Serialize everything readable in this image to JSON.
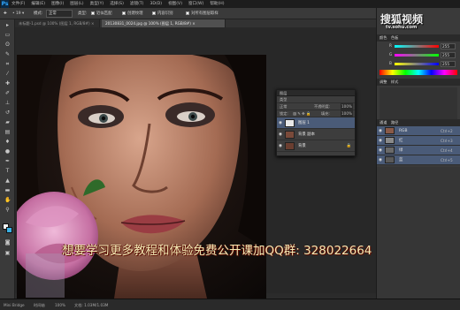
{
  "app": {
    "logo": "Ps"
  },
  "menu": [
    "文件(F)",
    "编辑(E)",
    "图像(I)",
    "图层(L)",
    "类型(Y)",
    "选择(S)",
    "滤镜(T)",
    "3D(D)",
    "视图(V)",
    "窗口(W)",
    "帮助(H)"
  ],
  "options": {
    "mode_label": "模式:",
    "mode_value": "正常",
    "type_label": "类型:",
    "type_value": "",
    "proximity": "近似匹配",
    "create_texture": "创建纹理",
    "content_aware": "内容识别",
    "all_layers": "对所有图层取样"
  },
  "tabs": [
    {
      "label": "未标题-1.psd @ 100% (图层 1, RGB/8#) ×",
      "active": false
    },
    {
      "label": "20130831_0024.jpg @ 100% (图层 1, RGB/8#) ×",
      "active": true
    }
  ],
  "watermark": "想要学习更多教程和体验免费公开课加QQ群: 328022664",
  "layers_panel": {
    "title": "图层",
    "kind_label": "类型",
    "blend_mode": "正常",
    "opacity_label": "不透明度:",
    "opacity_value": "100%",
    "lock_label": "锁定:",
    "fill_label": "填充:",
    "fill_value": "100%",
    "layers": [
      {
        "name": "图层 1",
        "selected": true,
        "locked": false
      },
      {
        "name": "背景 副本",
        "selected": false,
        "locked": false
      },
      {
        "name": "背景",
        "selected": false,
        "locked": true
      }
    ]
  },
  "right_panel": {
    "color_tab": "颜色",
    "swatches_tab": "色板",
    "sliders": [
      {
        "label": "R",
        "value": "255",
        "color": "#ff3b3b"
      },
      {
        "label": "G",
        "value": "255",
        "color": "#3bff3b"
      },
      {
        "label": "B",
        "value": "255",
        "color": "#3b7bff"
      }
    ],
    "adjust_tab": "调整",
    "styles_tab": "样式",
    "channels_tab": "通道",
    "paths_tab": "路径",
    "channels": [
      {
        "name": "RGB",
        "key": "Ctrl+2",
        "selected": true
      },
      {
        "name": "红",
        "key": "Ctrl+3",
        "selected": true
      },
      {
        "name": "绿",
        "key": "Ctrl+4",
        "selected": true
      },
      {
        "name": "蓝",
        "key": "Ctrl+5",
        "selected": true
      }
    ]
  },
  "status": {
    "zoom": "100%",
    "doc": "文档: 1.03M/1.03M",
    "mini_bridge": "Mini Bridge",
    "timeline": "时间轴"
  },
  "brand": {
    "main": "搜狐视频",
    "url": "tv.sohu.com"
  },
  "colors": {
    "accent_selected": "#4a5b78",
    "foreground": "#f2f2f2",
    "background": "#3ab0e4",
    "watermark_text": "#f4ebb6"
  }
}
